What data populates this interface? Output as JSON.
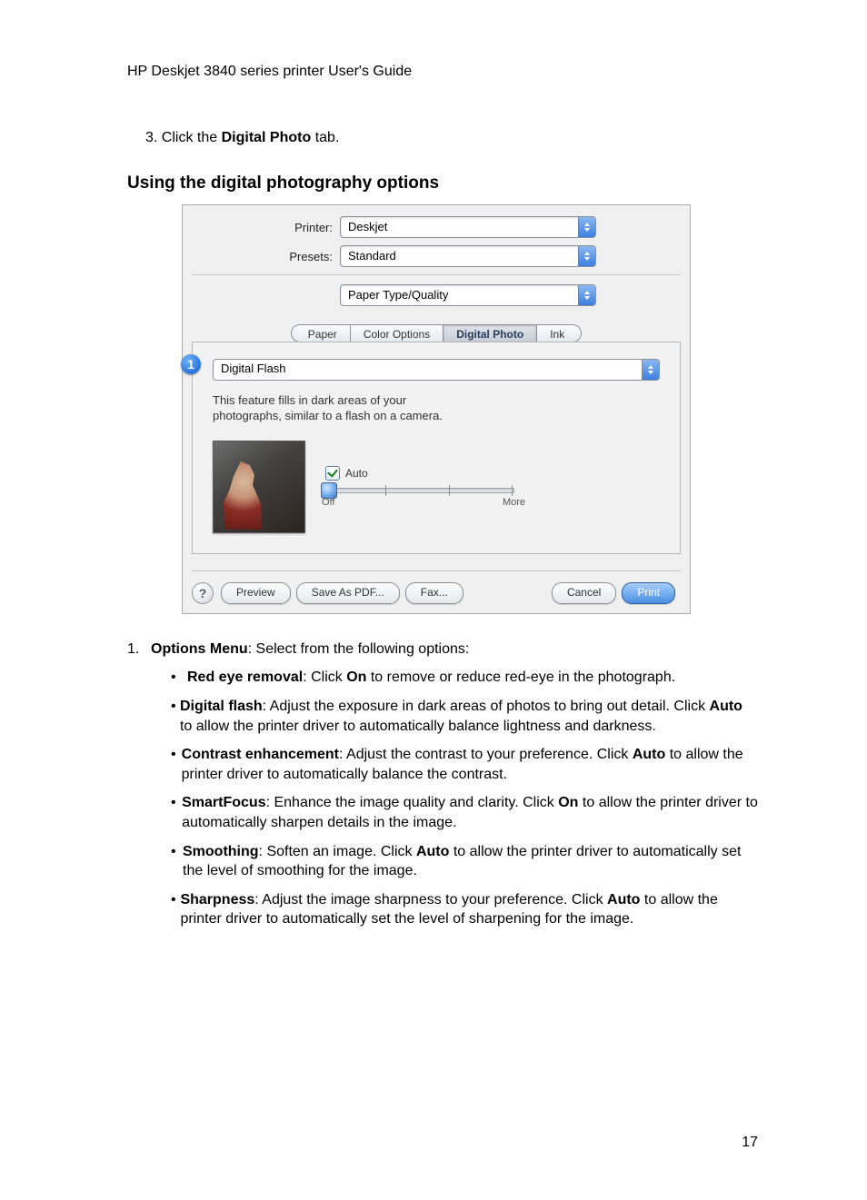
{
  "header": "HP Deskjet 3840 series printer User's Guide",
  "step_prefix": "3.  Click the ",
  "step_bold": "Digital Photo",
  "step_suffix": " tab.",
  "section_title": "Using the digital photography options",
  "dialog": {
    "printer_label": "Printer:",
    "printer_value": "Deskjet",
    "presets_label": "Presets:",
    "presets_value": "Standard",
    "panel_value": "Paper Type/Quality",
    "tabs": {
      "paper": "Paper",
      "color": "Color Options",
      "digital": "Digital Photo",
      "ink": "Ink"
    },
    "option_name": "Digital Flash",
    "desc1": "This feature fills in dark areas of your",
    "desc2": "photographs, similar to a flash on a camera.",
    "auto_label": "Auto",
    "slider_min": "Off",
    "slider_max": "More",
    "callout": "1",
    "buttons": {
      "help": "?",
      "preview": "Preview",
      "saveas": "Save As PDF...",
      "fax": "Fax...",
      "cancel": "Cancel",
      "print": "Print"
    }
  },
  "list": {
    "num": "1.",
    "lead_bold": "Options Menu",
    "lead_rest": ": Select from the following options:",
    "items": [
      {
        "b1": "Red eye removal",
        "t1": ": Click ",
        "b2": "On",
        "t2": " to remove or reduce red-eye in the photograph."
      },
      {
        "b1": "Digital flash",
        "t1": ": Adjust the exposure in dark areas of photos to bring out detail. Click ",
        "b2": "Auto",
        "t2": " to allow the printer driver to automatically balance lightness and darkness."
      },
      {
        "b1": "Contrast enhancement",
        "t1": ": Adjust the contrast to your preference. Click ",
        "b2": "Auto",
        "t2": " to allow the printer driver to automatically balance the contrast."
      },
      {
        "b1": "SmartFocus",
        "t1": ": Enhance the image quality and clarity. Click ",
        "b2": "On",
        "t2": " to allow the printer driver to automatically sharpen details in the image."
      },
      {
        "b1": "Smoothing",
        "t1": ": Soften an image. Click ",
        "b2": "Auto",
        "t2": " to allow the printer driver to automatically set the level of smoothing for the image."
      },
      {
        "b1": "Sharpness",
        "t1": ": Adjust the image sharpness to your preference. Click ",
        "b2": "Auto",
        "t2": " to allow the printer driver to automatically set the level of sharpening for the image."
      }
    ]
  },
  "page_number": "17"
}
